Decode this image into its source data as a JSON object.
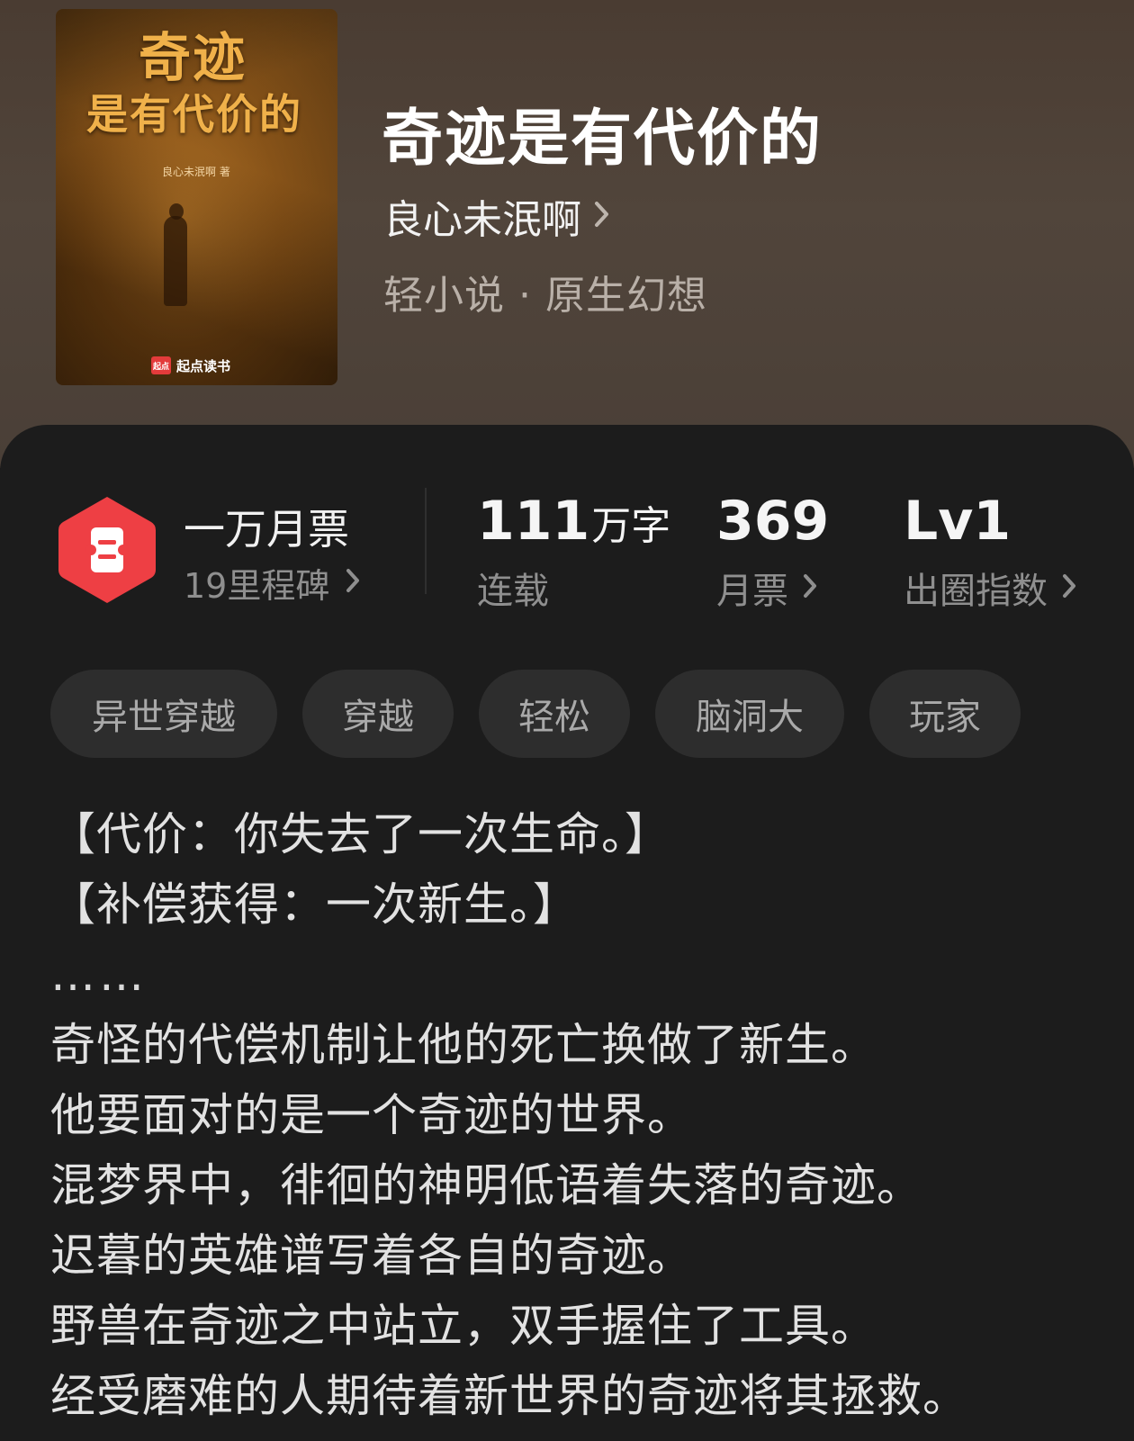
{
  "cover": {
    "title_line1": "奇迹",
    "title_line2": "是有代价的",
    "author_credit": "良心未泯啊 著",
    "brand_mark": "起点",
    "brand_name": "起点读书"
  },
  "book": {
    "title": "奇迹是有代价的",
    "author": "良心未泯啊",
    "genre": "轻小说 · 原生幻想"
  },
  "milestone": {
    "title": "一万月票",
    "subtitle": "19里程碑"
  },
  "stats": {
    "words_value": "111",
    "words_unit": "万字",
    "words_label": "连载",
    "votes_value": "369",
    "votes_label": "月票",
    "level_value": "Lv1",
    "level_label": "出圈指数"
  },
  "tags": [
    "异世穿越",
    "穿越",
    "轻松",
    "脑洞大",
    "玩家"
  ],
  "description": [
    "【代价：你失去了一次生命。】",
    "【补偿获得：一次新生。】",
    "……",
    "奇怪的代偿机制让他的死亡换做了新生。",
    "他要面对的是一个奇迹的世界。",
    "混梦界中，徘徊的神明低语着失落的奇迹。",
    "迟暮的英雄谱写着各自的奇迹。",
    "野兽在奇迹之中站立，双手握住了工具。",
    "经受磨难的人期待着新世界的奇迹将其拯救。"
  ],
  "colors": {
    "header_bg": "#4d4037",
    "panel_bg": "#1c1c1c",
    "badge_red": "#ee3f44",
    "tag_bg": "#2d2d2d"
  },
  "icons": {
    "badge": "ticket-badge-icon",
    "chevron": "chevron-right-icon"
  }
}
